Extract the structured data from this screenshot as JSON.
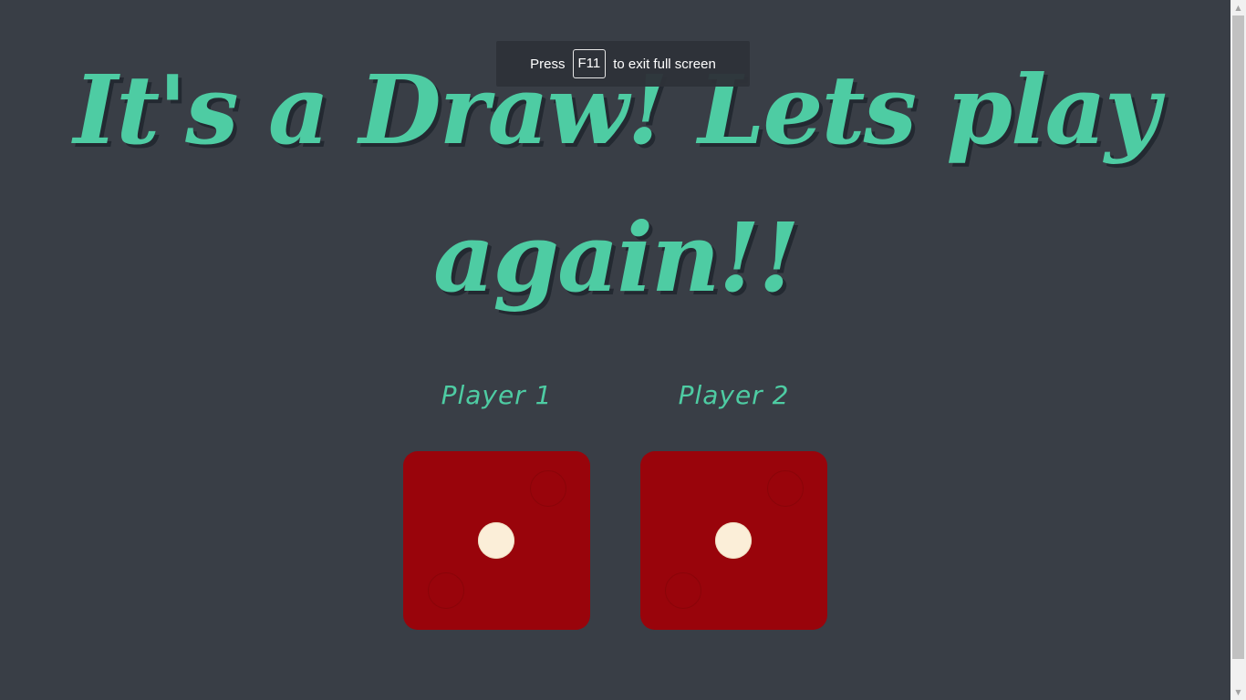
{
  "headline": {
    "text": "It's a Draw! Lets play again!!"
  },
  "players": [
    {
      "label": "Player 1",
      "die_value": 1
    },
    {
      "label": "Player 2",
      "die_value": 1
    }
  ],
  "fullscreen_notice": {
    "prefix": "Press",
    "key": "F11",
    "suffix": "to exit full screen"
  },
  "colors": {
    "background": "#393e46",
    "accent": "#4ecca3",
    "die_face": "#99040b",
    "pip": "#fbeed8"
  },
  "icons": {
    "scroll_up": "chevron-up-icon",
    "scroll_down": "chevron-down-icon"
  }
}
